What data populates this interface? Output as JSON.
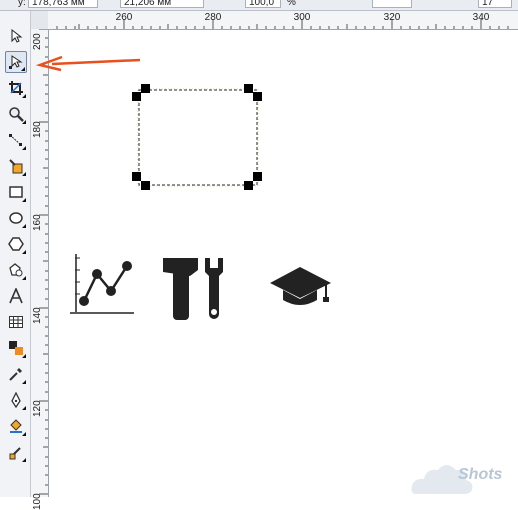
{
  "propertybar": {
    "y_label": "y:",
    "y_value": "178,763 мм",
    "h_value": "21,206 мм",
    "scale_value": "100,0",
    "scale_unit": "%",
    "extra_value": "17"
  },
  "ruler": {
    "horizontal": [
      "260",
      "280",
      "300",
      "320",
      "340"
    ],
    "vertical": [
      "200",
      "180",
      "160",
      "140",
      "120",
      "100"
    ]
  },
  "tools": [
    {
      "name": "pick-tool",
      "active": false
    },
    {
      "name": "shape-tool",
      "active": true
    },
    {
      "name": "crop-tool",
      "active": false
    },
    {
      "name": "zoom-tool",
      "active": false
    },
    {
      "name": "freehand-tool",
      "active": false
    },
    {
      "name": "smart-fill-tool",
      "active": false
    },
    {
      "name": "rectangle-tool",
      "active": false
    },
    {
      "name": "ellipse-tool",
      "active": false
    },
    {
      "name": "polygon-tool",
      "active": false
    },
    {
      "name": "basic-shapes-tool",
      "active": false
    },
    {
      "name": "text-tool",
      "active": false
    },
    {
      "name": "table-tool",
      "active": false
    },
    {
      "name": "blend-tool",
      "active": false
    },
    {
      "name": "eyedropper-tool",
      "active": false
    },
    {
      "name": "outline-tool",
      "active": false
    },
    {
      "name": "fill-tool",
      "active": false
    },
    {
      "name": "interactive-fill-tool",
      "active": false
    }
  ],
  "canvas": {
    "icons": [
      "chart-icon",
      "tools-icon",
      "graduation-cap-icon"
    ]
  },
  "colors": {
    "arrow": "#e8501e",
    "node": "#000000"
  },
  "watermark": "Shots"
}
